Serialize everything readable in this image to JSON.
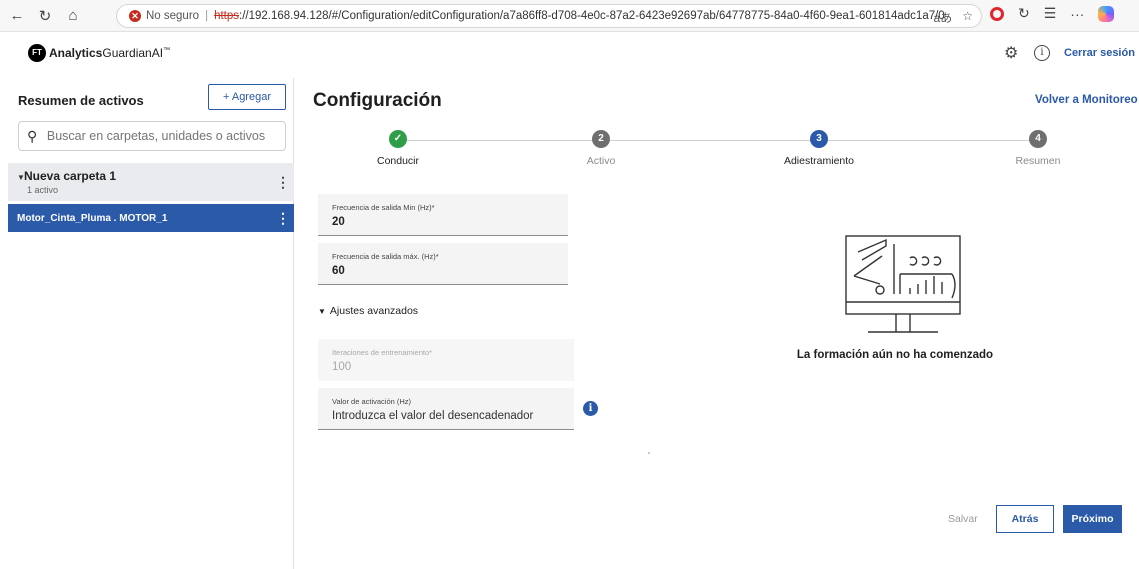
{
  "browser": {
    "back_icon": "←",
    "reload_icon": "↻",
    "home_icon": "⌂",
    "security_icon": "✕",
    "security_label": "No seguro",
    "separator": "|",
    "url_scheme": "https",
    "url_rest": "://192.168.94.128/#/Configuration/editConfiguration/a7a86ff8-d708-4e0c-87a2-6423e92697ab/64778775-84a0-4f60-9ea1-601814adc1a7/0",
    "read_aloud_icon": "aあ",
    "favorite_icon": "☆",
    "refresh_ext_icon": "↻",
    "collections_icon": "☰",
    "more_icon": "···"
  },
  "header": {
    "logo_badge": "FT",
    "logo_bold": "Analytics",
    "logo_suffix": "GuardianAI",
    "logo_tm": "™",
    "gear_icon": "⚙",
    "info_icon": "i",
    "logout_label": "Cerrar sesión"
  },
  "sidebar": {
    "title": "Resumen de activos",
    "add_label": "+ Agregar",
    "search_icon": "⚲",
    "search_placeholder": "Buscar en carpetas, unidades o activos",
    "folder": {
      "caret": "▼",
      "name": "Nueva carpeta 1",
      "count": "1 activo",
      "menu": "⋮"
    },
    "asset": {
      "name": "Motor_Cinta_Pluma . MOTOR_1",
      "menu": "⋮"
    }
  },
  "main": {
    "title": "Configuración",
    "back_link": "Volver a Monitoreo",
    "steps": [
      {
        "number": "✓",
        "label": "Conducir",
        "state": "complete"
      },
      {
        "number": "2",
        "label": "Activo",
        "state": "inactive"
      },
      {
        "number": "3",
        "label": "Adiestramiento",
        "state": "active"
      },
      {
        "number": "4",
        "label": "Resumen",
        "state": "inactive"
      }
    ],
    "fields": {
      "min_freq": {
        "label": "Frecuencia de salida Min (Hz)*",
        "value": "20"
      },
      "max_freq": {
        "label": "Frecuencia de salida máx. (Hz)*",
        "value": "60"
      },
      "iterations": {
        "label": "Iteraciones de entrenamiento*",
        "value": "100"
      },
      "trigger": {
        "label": "Valor de activación (Hz)",
        "placeholder": "Introduzca el valor del desencadenador"
      }
    },
    "advanced": {
      "caret": "▼",
      "label": "Ajustes avanzados"
    },
    "info_icon": "i",
    "illustration_caption": "La formación aún no ha comenzado",
    "buttons": {
      "save": "Salvar",
      "back": "Atrás",
      "next": "Próximo"
    }
  },
  "colors": {
    "primary": "#2a5aa8",
    "success": "#2e9e48",
    "inactive_step": "#6f6f6f"
  }
}
